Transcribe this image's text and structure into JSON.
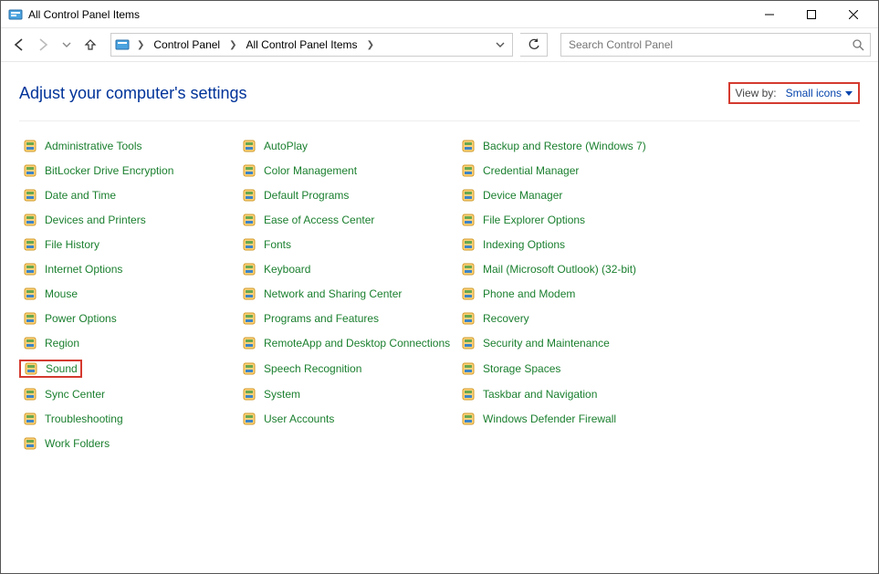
{
  "window": {
    "title": "All Control Panel Items"
  },
  "breadcrumb": {
    "root": "Control Panel",
    "current": "All Control Panel Items"
  },
  "search": {
    "placeholder": "Search Control Panel"
  },
  "heading": "Adjust your computer's settings",
  "viewby": {
    "label": "View by:",
    "value": "Small icons"
  },
  "columns": [
    [
      {
        "label": "Administrative Tools",
        "icon": "tools-icon",
        "hl": false
      },
      {
        "label": "BitLocker Drive Encryption",
        "icon": "lock-icon",
        "hl": false
      },
      {
        "label": "Date and Time",
        "icon": "clock-icon",
        "hl": false
      },
      {
        "label": "Devices and Printers",
        "icon": "printer-icon",
        "hl": false
      },
      {
        "label": "File History",
        "icon": "history-icon",
        "hl": false
      },
      {
        "label": "Internet Options",
        "icon": "globe-icon",
        "hl": false
      },
      {
        "label": "Mouse",
        "icon": "mouse-icon",
        "hl": false
      },
      {
        "label": "Power Options",
        "icon": "power-icon",
        "hl": false
      },
      {
        "label": "Region",
        "icon": "region-icon",
        "hl": false
      },
      {
        "label": "Sound",
        "icon": "speaker-icon",
        "hl": true
      },
      {
        "label": "Sync Center",
        "icon": "sync-icon",
        "hl": false
      },
      {
        "label": "Troubleshooting",
        "icon": "wrench-icon",
        "hl": false
      },
      {
        "label": "Work Folders",
        "icon": "folder-icon",
        "hl": false
      }
    ],
    [
      {
        "label": "AutoPlay",
        "icon": "media-icon",
        "hl": false
      },
      {
        "label": "Color Management",
        "icon": "color-icon",
        "hl": false
      },
      {
        "label": "Default Programs",
        "icon": "default-icon",
        "hl": false
      },
      {
        "label": "Ease of Access Center",
        "icon": "ease-icon",
        "hl": false
      },
      {
        "label": "Fonts",
        "icon": "font-icon",
        "hl": false
      },
      {
        "label": "Keyboard",
        "icon": "keyboard-icon",
        "hl": false
      },
      {
        "label": "Network and Sharing Center",
        "icon": "network-icon",
        "hl": false
      },
      {
        "label": "Programs and Features",
        "icon": "programs-icon",
        "hl": false
      },
      {
        "label": "RemoteApp and Desktop Connections",
        "icon": "remote-icon",
        "hl": false
      },
      {
        "label": "Speech Recognition",
        "icon": "mic-icon",
        "hl": false
      },
      {
        "label": "System",
        "icon": "system-icon",
        "hl": false
      },
      {
        "label": "User Accounts",
        "icon": "users-icon",
        "hl": false
      }
    ],
    [
      {
        "label": "Backup and Restore (Windows 7)",
        "icon": "backup-icon",
        "hl": false
      },
      {
        "label": "Credential Manager",
        "icon": "vault-icon",
        "hl": false
      },
      {
        "label": "Device Manager",
        "icon": "device-icon",
        "hl": false
      },
      {
        "label": "File Explorer Options",
        "icon": "folder-options-icon",
        "hl": false
      },
      {
        "label": "Indexing Options",
        "icon": "index-icon",
        "hl": false
      },
      {
        "label": "Mail (Microsoft Outlook) (32-bit)",
        "icon": "mail-icon",
        "hl": false
      },
      {
        "label": "Phone and Modem",
        "icon": "phone-icon",
        "hl": false
      },
      {
        "label": "Recovery",
        "icon": "recovery-icon",
        "hl": false
      },
      {
        "label": "Security and Maintenance",
        "icon": "flag-icon",
        "hl": false
      },
      {
        "label": "Storage Spaces",
        "icon": "storage-icon",
        "hl": false
      },
      {
        "label": "Taskbar and Navigation",
        "icon": "taskbar-icon",
        "hl": false
      },
      {
        "label": "Windows Defender Firewall",
        "icon": "firewall-icon",
        "hl": false
      }
    ]
  ]
}
